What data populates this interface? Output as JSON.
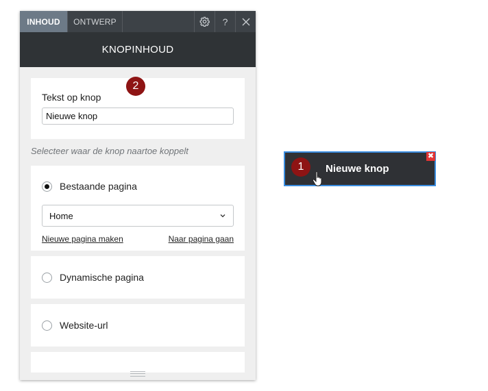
{
  "panel": {
    "tabs": [
      {
        "label": "INHOUD",
        "active": true
      },
      {
        "label": "ONTWERP",
        "active": false
      }
    ],
    "toolbar": {
      "settings_icon": "gear-icon",
      "help_label": "?",
      "close_icon": "close-icon"
    },
    "header_title": "KNOPINHOUD",
    "text_card": {
      "label": "Tekst op knop",
      "value": "Nieuwe knop"
    },
    "hint": "Selecteer waar de knop naartoe koppelt",
    "existing_page": {
      "label": "Bestaande pagina",
      "selected": true,
      "dropdown_value": "Home",
      "link_new": "Nieuwe pagina maken",
      "link_goto": "Naar pagina gaan"
    },
    "dynamic_page": {
      "label": "Dynamische pagina",
      "selected": false
    },
    "website_url": {
      "label": "Website-url",
      "selected": false
    }
  },
  "badges": {
    "one": "1",
    "two": "2"
  },
  "canvas_button": {
    "label": "Nieuwe knop",
    "close_glyph": "✖",
    "border_color": "#3a8de0"
  },
  "colors": {
    "badge": "#8e1414",
    "topbar": "#3d4247",
    "header": "#2f3336",
    "active_tab": "#6d7a87"
  }
}
